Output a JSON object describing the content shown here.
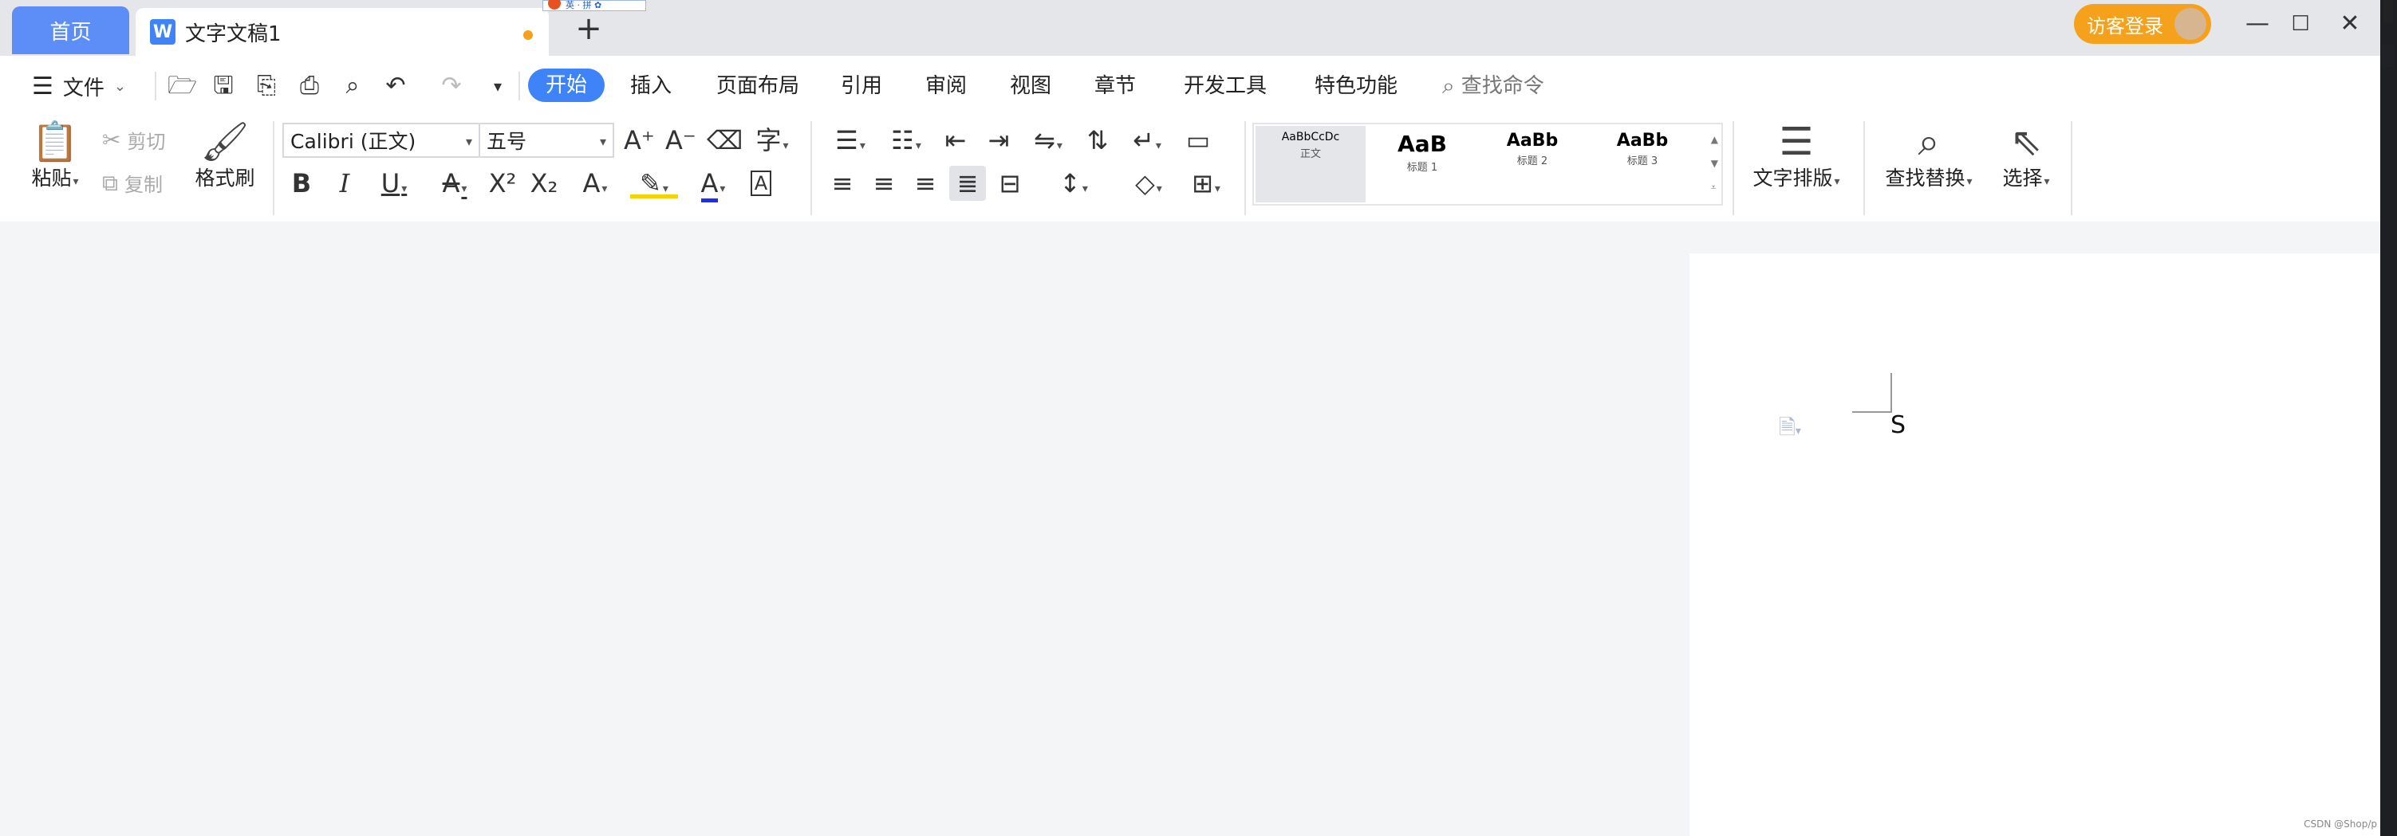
{
  "titlebar": {
    "home_tab": "首页",
    "doc_tab": "文字文稿1",
    "new_tab": "+",
    "ime": "英 · 拼 ✿",
    "login": "访客登录",
    "min": "—",
    "max": "☐",
    "close": "✕"
  },
  "menubar": {
    "file": "文件",
    "tabs": [
      "开始",
      "插入",
      "页面布局",
      "引用",
      "审阅",
      "视图",
      "章节",
      "开发工具",
      "特色功能"
    ],
    "search": "查找命令"
  },
  "ribbon": {
    "paste": "粘贴",
    "cut": "剪切",
    "copy": "复制",
    "format_painter": "格式刷",
    "font_name": "Calibri (正文)",
    "font_size": "五号",
    "styles": [
      {
        "sample": "AaBbCcDc",
        "caption": "正文"
      },
      {
        "sample": "AaB",
        "caption": "标题 1"
      },
      {
        "sample": "AaBb",
        "caption": "标题 2"
      },
      {
        "sample": "AaBb",
        "caption": "标题 3"
      }
    ],
    "text_layout": "文字排版",
    "find_replace": "查找替换",
    "select": "选择"
  },
  "document": {
    "text": "S"
  },
  "watermark": "CSDN @Shop/p"
}
